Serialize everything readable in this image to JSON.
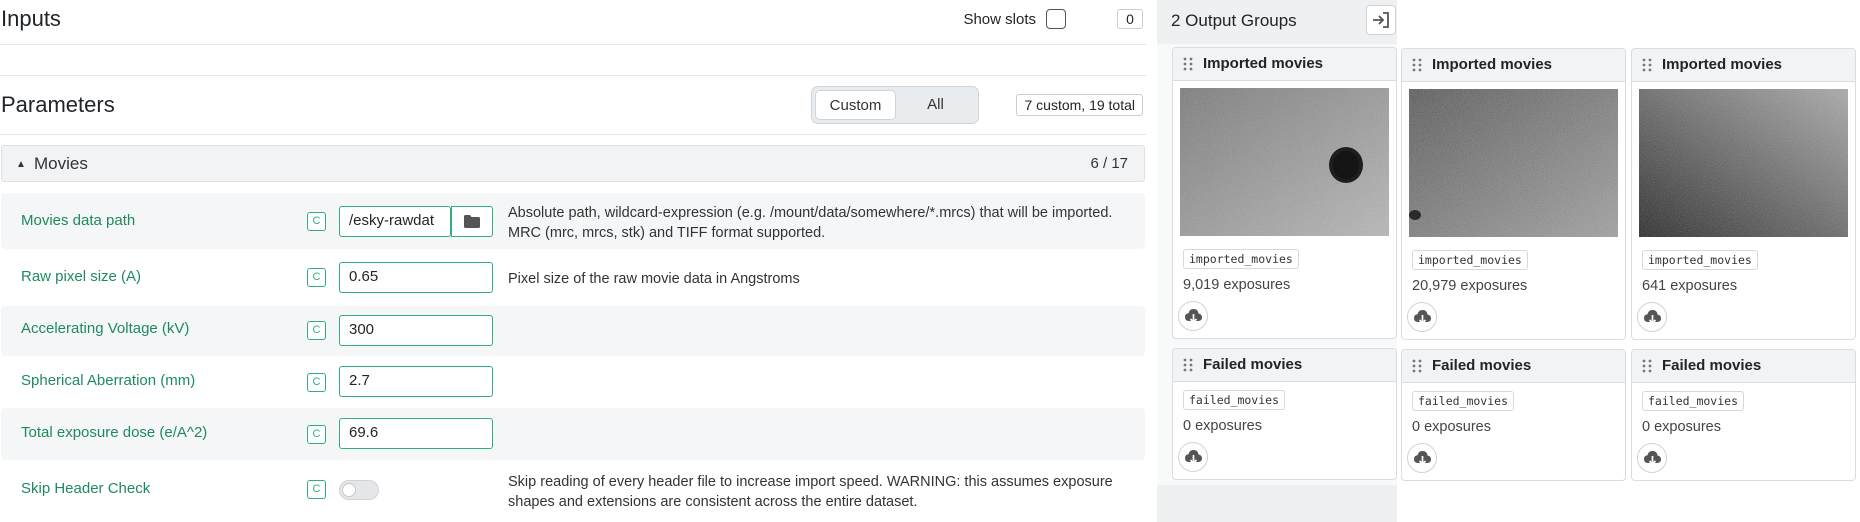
{
  "inputs": {
    "title": "Inputs",
    "show_slots_label": "Show slots",
    "slot_count": "0"
  },
  "parameters": {
    "title": "Parameters",
    "scope_options": [
      "Custom",
      "All"
    ],
    "scope_selected": "Custom",
    "count_label": "7 custom, 19 total"
  },
  "section": {
    "label": "Movies",
    "count": "6 / 17"
  },
  "params": [
    {
      "name": "Movies data path",
      "badge": "C",
      "value": "/esky-rawdat",
      "description": "Absolute path, wildcard-expression (e.g. /mount/data/somewhere/*.mrcs) that will be imported. MRC (mrc, mrcs, stk) and TIFF format supported.",
      "has_browse": true
    },
    {
      "name": "Raw pixel size (A)",
      "badge": "C",
      "value": "0.65",
      "description": "Pixel size of the raw movie data in Angstroms"
    },
    {
      "name": "Accelerating Voltage (kV)",
      "badge": "C",
      "value": "300",
      "description": ""
    },
    {
      "name": "Spherical Aberration (mm)",
      "badge": "C",
      "value": "2.7",
      "description": ""
    },
    {
      "name": "Total exposure dose (e/A^2)",
      "badge": "C",
      "value": "69.6",
      "description": ""
    },
    {
      "name": "Skip Header Check",
      "badge": "C",
      "toggle_on": false,
      "description": "Skip reading of every header file to increase import speed. WARNING: this assumes exposure shapes and extensions are consistent across the entire dataset."
    }
  ],
  "outputs": {
    "title": "2 Output Groups",
    "imported": [
      {
        "title": "Imported movies",
        "tag": "imported_movies",
        "exposures": "9,019 exposures"
      },
      {
        "title": "Imported movies",
        "tag": "imported_movies",
        "exposures": "20,979 exposures"
      },
      {
        "title": "Imported movies",
        "tag": "imported_movies",
        "exposures": "641 exposures"
      }
    ],
    "failed": [
      {
        "title": "Failed movies",
        "tag": "failed_movies",
        "exposures": "0 exposures"
      },
      {
        "title": "Failed movies",
        "tag": "failed_movies",
        "exposures": "0 exposures"
      },
      {
        "title": "Failed movies",
        "tag": "failed_movies",
        "exposures": "0 exposures"
      }
    ]
  },
  "colors": {
    "accent_green": "#2fb07a",
    "param_name_green": "#1f8a5e"
  },
  "icons": {
    "folder": "folder-icon",
    "collapse": "collapse-panel-icon",
    "grip": "drag-grip-icon",
    "download": "cloud-download-icon",
    "caret": "caret-up-icon"
  }
}
